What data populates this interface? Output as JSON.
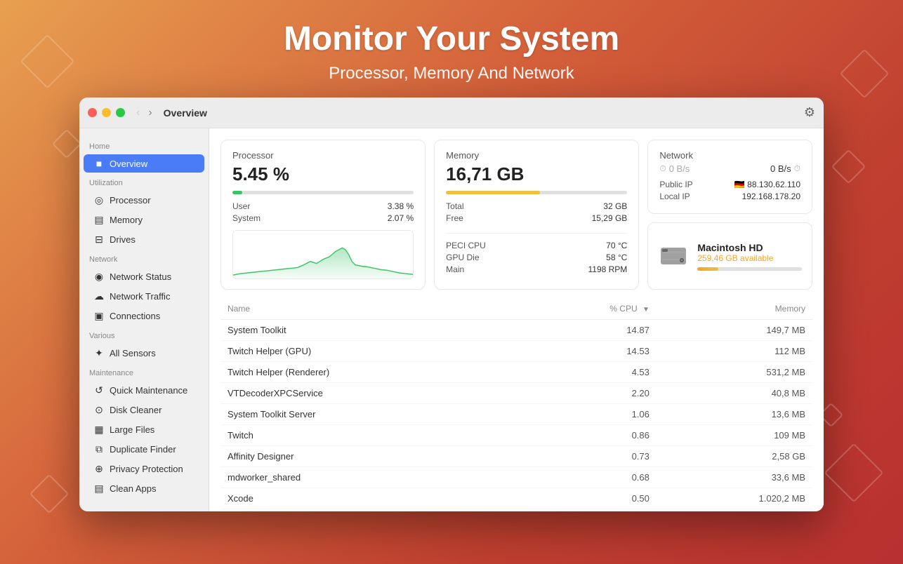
{
  "page": {
    "title": "Monitor Your System",
    "subtitle": "Processor, Memory And Network"
  },
  "titlebar": {
    "title": "Overview",
    "back_label": "‹",
    "forward_label": "›",
    "settings_label": "⚙"
  },
  "sidebar": {
    "sections": [
      {
        "label": "Home",
        "items": [
          {
            "id": "overview",
            "label": "Overview",
            "icon": "■■",
            "active": true
          }
        ]
      },
      {
        "label": "Utilization",
        "items": [
          {
            "id": "processor",
            "label": "Processor",
            "icon": "◎",
            "active": false
          },
          {
            "id": "memory",
            "label": "Memory",
            "icon": "▤",
            "active": false
          },
          {
            "id": "drives",
            "label": "Drives",
            "icon": "⊟",
            "active": false
          }
        ]
      },
      {
        "label": "Network",
        "items": [
          {
            "id": "network-status",
            "label": "Network Status",
            "icon": "◉",
            "active": false
          },
          {
            "id": "network-traffic",
            "label": "Network Traffic",
            "icon": "☁",
            "active": false
          },
          {
            "id": "connections",
            "label": "Connections",
            "icon": "▣",
            "active": false
          }
        ]
      },
      {
        "label": "Various",
        "items": [
          {
            "id": "all-sensors",
            "label": "All Sensors",
            "icon": "✦",
            "active": false
          }
        ]
      },
      {
        "label": "Maintenance",
        "items": [
          {
            "id": "quick-maintenance",
            "label": "Quick Maintenance",
            "icon": "↺",
            "active": false
          },
          {
            "id": "disk-cleaner",
            "label": "Disk Cleaner",
            "icon": "⊙",
            "active": false
          },
          {
            "id": "large-files",
            "label": "Large Files",
            "icon": "▦",
            "active": false
          },
          {
            "id": "duplicate-finder",
            "label": "Duplicate Finder",
            "icon": "⧉",
            "active": false
          },
          {
            "id": "privacy-protection",
            "label": "Privacy Protection",
            "icon": "⊕",
            "active": false
          },
          {
            "id": "clean-apps",
            "label": "Clean Apps",
            "icon": "▤",
            "active": false
          }
        ]
      }
    ]
  },
  "processor": {
    "title": "Processor",
    "value": "5.45 %",
    "progress": 5.45,
    "user_label": "User",
    "user_value": "3.38 %",
    "system_label": "System",
    "system_value": "2.07 %"
  },
  "memory": {
    "title": "Memory",
    "value": "16,71 GB",
    "progress": 52,
    "total_label": "Total",
    "total_value": "32 GB",
    "free_label": "Free",
    "free_value": "15,29 GB"
  },
  "network": {
    "title": "Network",
    "in_label": "0 B/s",
    "out_label": "0 B/s",
    "public_ip_label": "Public IP",
    "public_ip_value": "88.130.62.110",
    "public_ip_flag": "🇩🇪",
    "local_ip_label": "Local IP",
    "local_ip_value": "192.168.178.20"
  },
  "disk": {
    "name": "Macintosh HD",
    "available": "259,46 GB available",
    "fill_percent": 20
  },
  "sensors": {
    "peci_label": "PECI CPU",
    "peci_value": "70 °C",
    "gpu_label": "GPU Die",
    "gpu_value": "58 °C",
    "main_label": "Main",
    "main_value": "1198 RPM"
  },
  "table": {
    "col_name": "Name",
    "col_cpu": "% CPU",
    "col_memory": "Memory",
    "rows": [
      {
        "name": "System Toolkit",
        "cpu": "14.87",
        "memory": "149,7 MB"
      },
      {
        "name": "Twitch Helper (GPU)",
        "cpu": "14.53",
        "memory": "112 MB"
      },
      {
        "name": "Twitch Helper (Renderer)",
        "cpu": "4.53",
        "memory": "531,2 MB"
      },
      {
        "name": "VTDecoderXPCService",
        "cpu": "2.20",
        "memory": "40,8 MB"
      },
      {
        "name": "System Toolkit Server",
        "cpu": "1.06",
        "memory": "13,6 MB"
      },
      {
        "name": "Twitch",
        "cpu": "0.86",
        "memory": "109 MB"
      },
      {
        "name": "Affinity Designer",
        "cpu": "0.73",
        "memory": "2,58 GB"
      },
      {
        "name": "mdworker_shared",
        "cpu": "0.68",
        "memory": "33,6 MB"
      },
      {
        "name": "Xcode",
        "cpu": "0.50",
        "memory": "1.020,2 MB"
      }
    ]
  }
}
